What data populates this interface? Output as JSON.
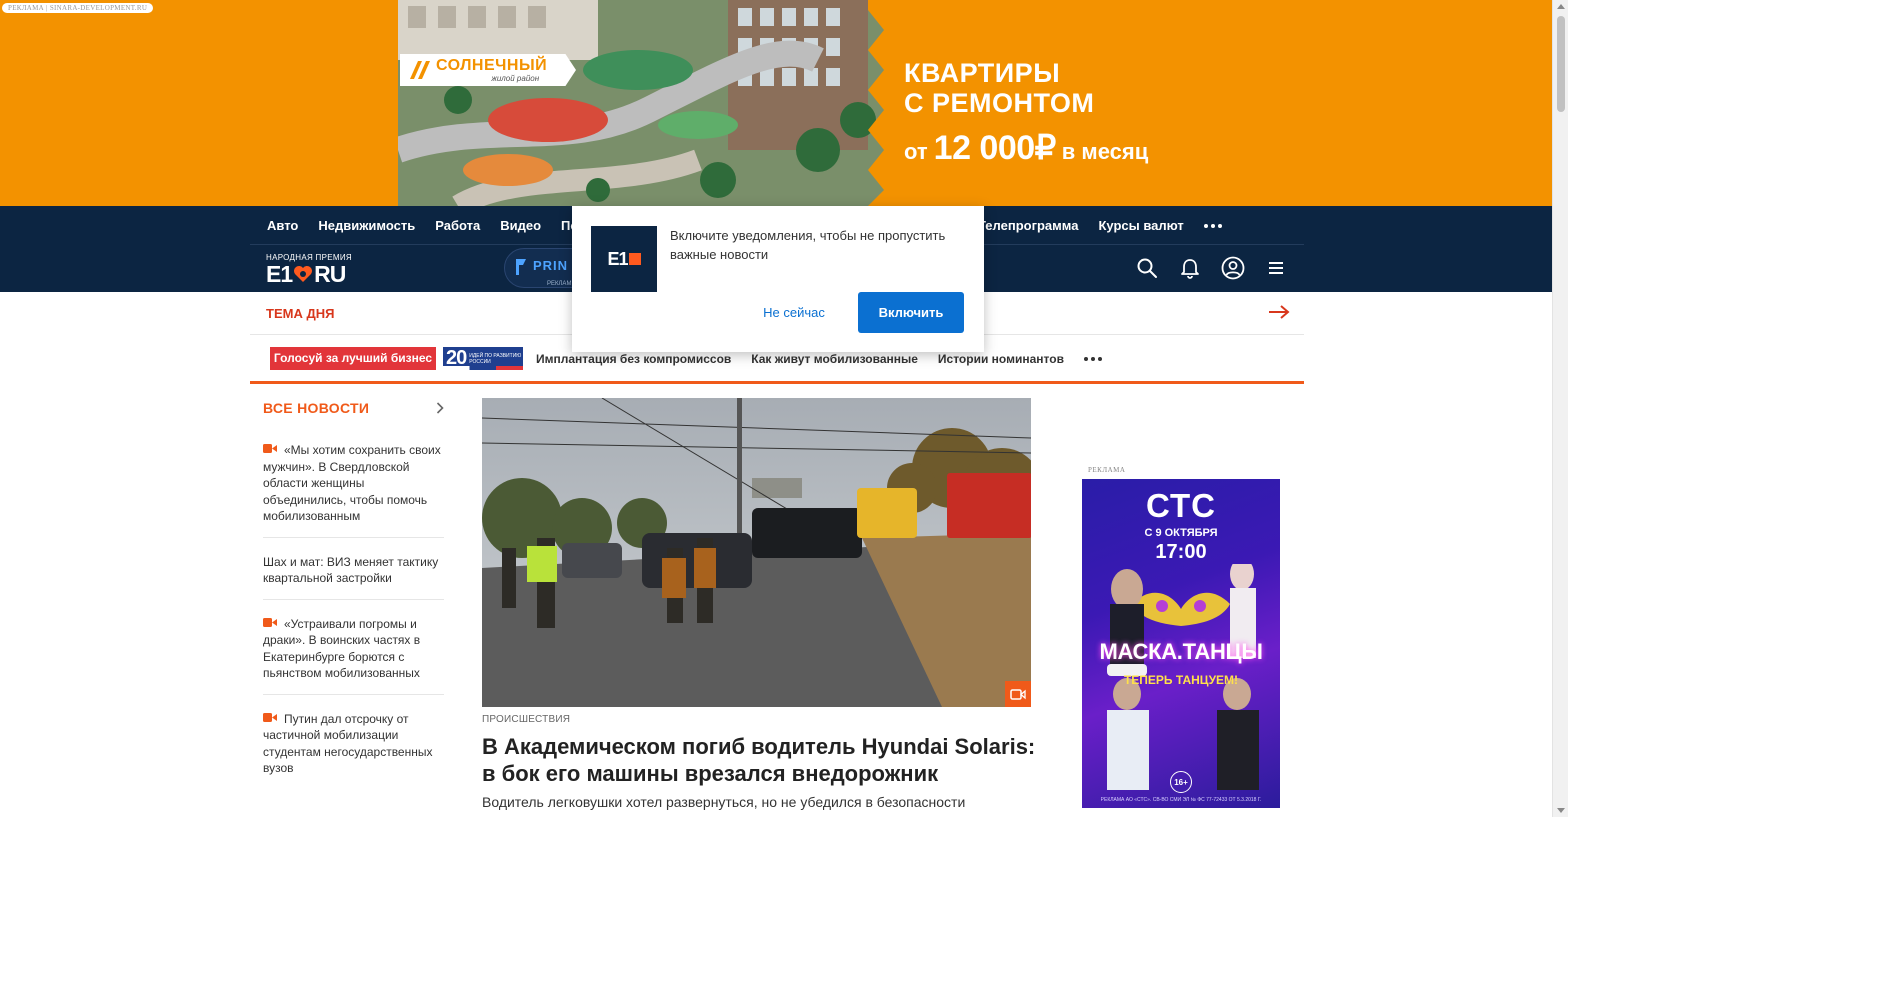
{
  "banner": {
    "ad_tag": "РЕКЛАМА | SINARA-DEVELOPMENT.RU",
    "brand_name": "СОЛНЕЧНЫЙ",
    "brand_sub": "жилой район",
    "headline_line1": "КВАРТИРЫ",
    "headline_line2": "С РЕМОНТОМ",
    "price_prefix": "от",
    "price_value": "12 000₽",
    "price_suffix": "в месяц",
    "background_color": "#f39200"
  },
  "nav": {
    "left_items": [
      "Авто",
      "Недвижимость",
      "Работа",
      "Видео",
      "Почта"
    ],
    "right_items": [
      "Телепрограмма",
      "Курсы валют"
    ],
    "background_color": "#0c2542"
  },
  "logo": {
    "award": "НАРОДНАЯ ПРЕМИЯ",
    "word_left": "E1",
    "word_right": "RU"
  },
  "header_ad": {
    "text": "PRIN",
    "label": "РЕКЛАМ"
  },
  "header_icons": [
    "search-icon",
    "bell-icon",
    "user-icon",
    "menu-icon"
  ],
  "popup": {
    "logo_text": "E1",
    "message": "Включите уведомления, чтобы не пропустить важные новости",
    "later_label": "Не сейчас",
    "enable_label": "Включить",
    "accent_color": "#0b70d1"
  },
  "theme": {
    "label": "ТЕМА ДНЯ",
    "red_tag": "Голосуй за лучший бизнес",
    "badge_number": "20",
    "badge_text": "ИДЕЙ ПО РАЗВИТИЮ РОССИИ",
    "links": [
      "Имплантация без компромиссов",
      "Как живут мобилизованные",
      "Истории номинантов"
    ]
  },
  "news": {
    "heading": "ВСЕ НОВОСТИ",
    "items": [
      {
        "video": true,
        "text": "«Мы хотим сохранить своих мужчин». В Свердловской области женщины объединились, чтобы помочь мобилизованным"
      },
      {
        "video": false,
        "text": "Шах и мат: ВИЗ меняет тактику квартальной застройки"
      },
      {
        "video": true,
        "text": "«Устраивали погромы и драки». В воинских частях в Екатеринбурге борются с пьянством мобилизованных"
      },
      {
        "video": true,
        "text": "Путин дал отсрочку от частичной мобилизации студентам негосударственных вузов"
      }
    ]
  },
  "article": {
    "rubric": "ПРОИСШЕСТВИЯ",
    "headline": "В Академическом погиб водитель Hyundai Solaris: в бок его машины врезался внедорожник",
    "lead": "Водитель легковушки хотел развернуться, но не убедился в безопасности"
  },
  "right_ad": {
    "label": "РЕКЛАМА",
    "channel": "СТС",
    "date": "С 9 ОКТЯБРЯ",
    "time": "17:00",
    "show": "МАСКА.ТАНЦЫ",
    "tagline": "ТЕПЕРЬ ТАНЦУЕМ!",
    "age": "16+",
    "legal": "РЕКЛАМА АО «СТС». СВ-ВО СМИ ЭЛ № ФС 77-72433 ОТ 5.3.2018 Г."
  },
  "accent_color": "#f05a1a"
}
